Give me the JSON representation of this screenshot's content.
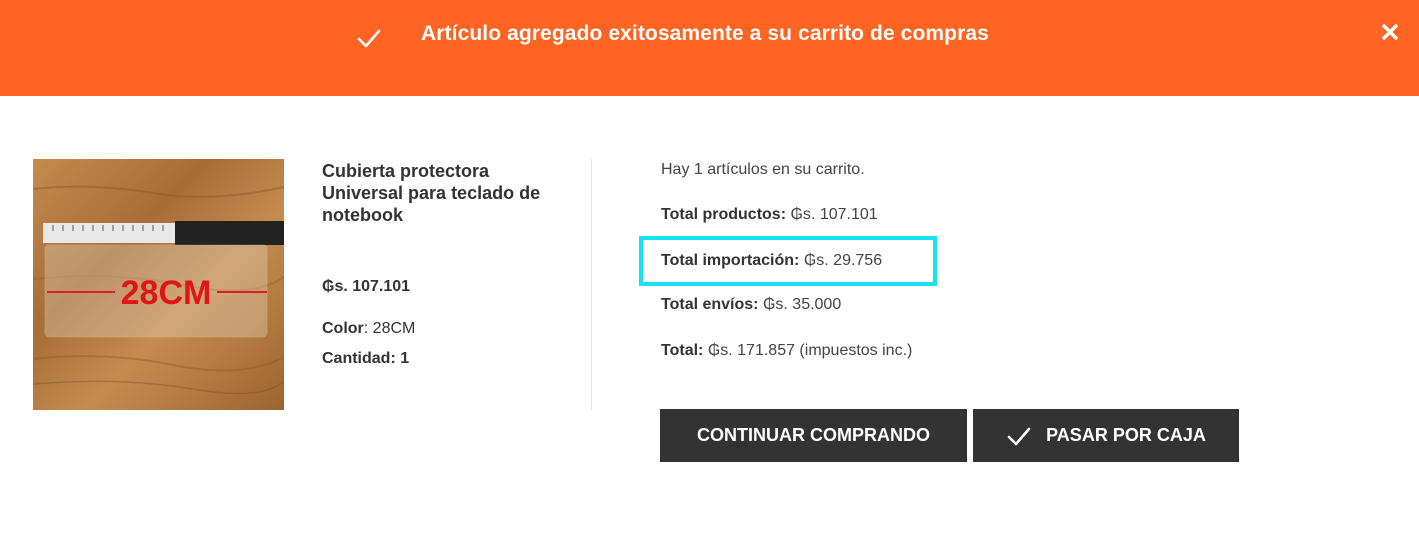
{
  "notification": {
    "title": "Artículo agregado exitosamente a su carrito de compras",
    "check_icon": "check-icon",
    "close_icon": "close-icon",
    "background": "#ff6422"
  },
  "product": {
    "image_label": "28CM",
    "name": "Cubierta protectora Universal para teclado de notebook",
    "price": "₲s. 107.101",
    "color_label": "Color",
    "color_value": ": 28CM",
    "quantity_label": "Cantidad:",
    "quantity_value": "1"
  },
  "cart": {
    "count_text": "Hay 1 artículos en su carrito.",
    "total_products_label": "Total productos:",
    "total_products_value": "₲s. 107.101",
    "total_import_label": "Total importación:",
    "total_import_value": "₲s. 29.756",
    "total_shipping_label": "Total envíos:",
    "total_shipping_value": "₲s. 35.000",
    "total_label": "Total:",
    "total_value": "₲s. 171.857 (impuestos inc.)",
    "highlight_color": "#17e2f0"
  },
  "actions": {
    "continue_label": "CONTINUAR COMPRANDO",
    "checkout_label": "PASAR POR CAJA"
  }
}
